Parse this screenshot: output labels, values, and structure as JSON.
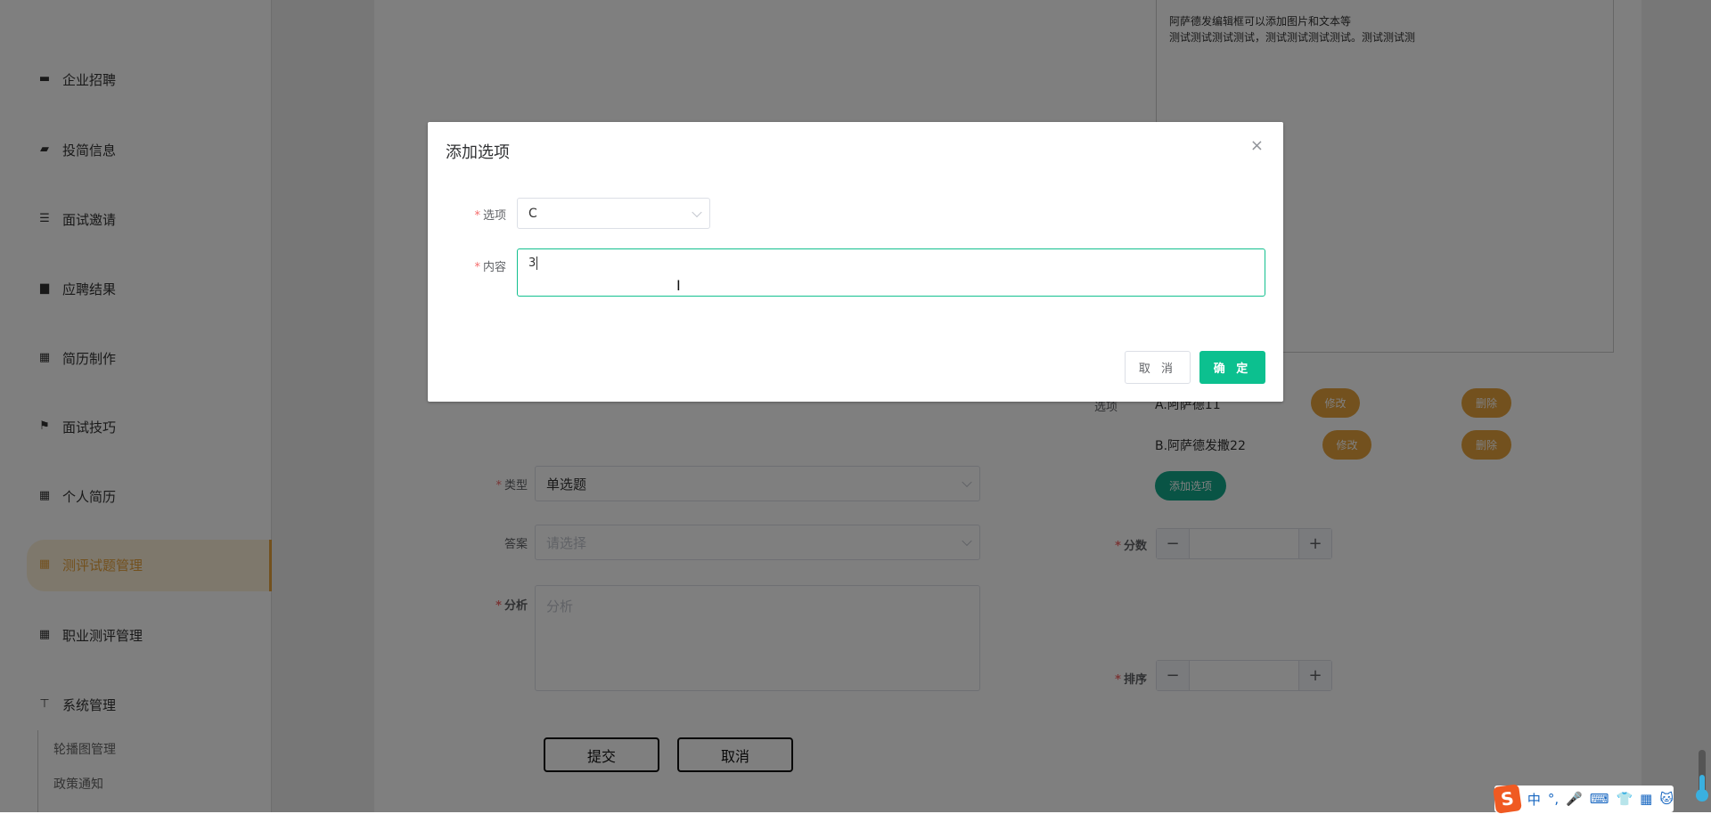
{
  "sidebar": {
    "items": [
      {
        "label": "企业招聘",
        "icon": "monitor-icon"
      },
      {
        "label": "投简信息",
        "icon": "wallet-icon"
      },
      {
        "label": "面试邀请",
        "icon": "sliders-icon"
      },
      {
        "label": "应聘结果",
        "icon": "chat-icon"
      },
      {
        "label": "简历制作",
        "icon": "grid-icon"
      },
      {
        "label": "面试技巧",
        "icon": "flag-icon"
      },
      {
        "label": "个人简历",
        "icon": "grid-icon"
      },
      {
        "label": "测评试题管理",
        "icon": "grid-icon",
        "active": true
      },
      {
        "label": "职业测评管理",
        "icon": "grid-icon"
      },
      {
        "label": "系统管理",
        "icon": "signpost-icon"
      }
    ],
    "sub_items": [
      "轮播图管理",
      "政策通知"
    ]
  },
  "editor": {
    "lines": [
      "阿萨德发编辑框可以添加图片和文本等",
      "测试测试测试测试，测试测试测试测试。测试测试测"
    ]
  },
  "options": {
    "label": "选项",
    "items": [
      {
        "text": "A.阿萨德11",
        "edit": "修改",
        "delete": "删除"
      },
      {
        "text": "B.阿萨德发撒22",
        "edit": "修改",
        "delete": "删除"
      }
    ],
    "add_label": "添加选项"
  },
  "form": {
    "type": {
      "label": "类型",
      "value": "单选题"
    },
    "answer": {
      "label": "答案",
      "placeholder": "请选择"
    },
    "analysis": {
      "label": "分析",
      "placeholder": "分析"
    },
    "score": {
      "label": "分数",
      "minus": "−",
      "plus": "+"
    },
    "sort": {
      "label": "排序",
      "minus": "−",
      "plus": "+"
    },
    "submit": "提交",
    "cancel": "取消"
  },
  "dialog": {
    "title": "添加选项",
    "close": "×",
    "option": {
      "label": "选项",
      "value": "C"
    },
    "content": {
      "label": "内容",
      "value": "3"
    },
    "cancel": "取 消",
    "confirm": "确 定"
  },
  "ime": {
    "items": [
      "S",
      "中",
      "°,",
      "🎤",
      "⌨",
      "👕",
      "▦",
      "🐱"
    ]
  },
  "colors": {
    "accent_green": "#0cc08f",
    "warning_orange": "#e6a23c",
    "required_red": "#f56c6c"
  }
}
